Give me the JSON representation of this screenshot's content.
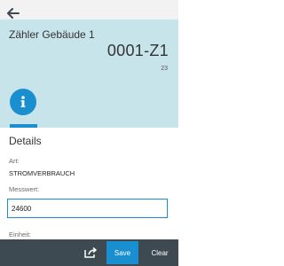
{
  "header": {
    "back_icon": "arrow-left-icon",
    "title": "Zähler Gebäude 1",
    "number": "0001-Z1",
    "sub_number": "23",
    "info_tab_icon": "info-icon"
  },
  "details": {
    "section_title": "Details",
    "art_label": "Art:",
    "art_value": "STROMVERBRAUCH",
    "messwert_label": "Messwert:",
    "messwert_value": "24600",
    "einheit_label": "Einheit:"
  },
  "footer": {
    "share_icon": "share-icon",
    "save_label": "Save",
    "clear_label": "Clear"
  },
  "colors": {
    "accent": "#1a8fd0",
    "header_bg": "#c8e4eb",
    "footer_bg": "#3d4a52"
  }
}
